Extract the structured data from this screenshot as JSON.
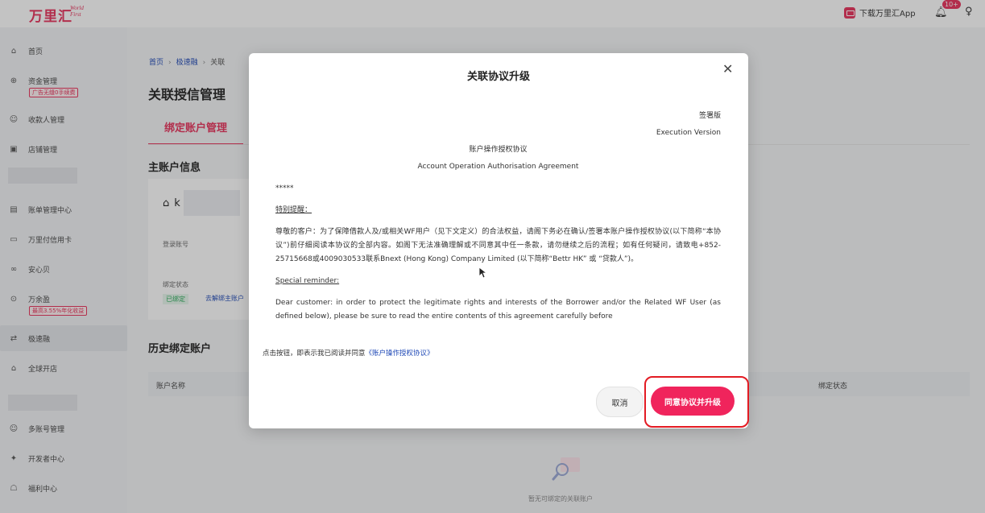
{
  "header": {
    "logo_cn": "万里汇",
    "logo_en_1": "World",
    "logo_en_2": "First",
    "download_app": "下载万里汇App",
    "notification_badge": "10+"
  },
  "sidebar": {
    "items": [
      {
        "label": "首页"
      },
      {
        "label": "资金管理",
        "tag": "广告无缝0手续费"
      },
      {
        "label": "收款人管理"
      },
      {
        "label": "店铺管理"
      },
      {
        "label": "账单管理中心"
      },
      {
        "label": "万里付信用卡"
      },
      {
        "label": "安心贝"
      },
      {
        "label": "万余盈",
        "tag": "最高3.55%年化收益"
      },
      {
        "label": "极速融"
      },
      {
        "label": "全球开店"
      },
      {
        "label": "多账号管理"
      },
      {
        "label": "开发者中心"
      },
      {
        "label": "福利中心"
      }
    ]
  },
  "page": {
    "breadcrumb": [
      "首页",
      "极速融",
      "关联"
    ],
    "title": "关联授信管理",
    "tab": "绑定账户管理",
    "main_section": "主账户信息",
    "account_prefix": "k",
    "login_label": "登录账号",
    "status_label": "绑定状态",
    "status_value": "已绑定",
    "status_link": "去解绑主账户",
    "history_section": "历史绑定账户",
    "table_col_name": "账户名称",
    "table_col_status": "绑定状态",
    "empty_text": "暂无可绑定的关联账户"
  },
  "modal": {
    "title": "关联协议升级",
    "version_cn": "签署版",
    "version_en": "Execution Version",
    "agreement_cn": "账户操作授权协议",
    "agreement_en": "Account Operation Authorisation Agreement",
    "stars": "*****",
    "special_cn": "特别提醒：",
    "para_cn": "尊敬的客户：为了保障借款人及/或相关WF用户（见下文定义）的合法权益，请阁下务必在确认/签署本账户操作授权协议(以下简称“本协议”)前仔细阅读本协议的全部内容。如阁下无法准确理解或不同意其中任一条款，请勿继续之后的流程；如有任何疑问，请致电+852-25715668或4009030533联系Bnext (Hong Kong) Company Limited (以下简称“Bettr HK” 或 “贷款人”)。",
    "special_en": "Special reminder:",
    "para_en": "Dear customer: in order to protect the legitimate rights and interests of the Borrower and/or the Related WF User (as defined below), please be sure to read the entire contents of this agreement carefully before",
    "agree_prefix": "点击按钮，即表示我已阅读并同意",
    "agree_link": "《账户操作授权协议》",
    "cancel": "取消",
    "confirm": "同意协议并升级"
  }
}
